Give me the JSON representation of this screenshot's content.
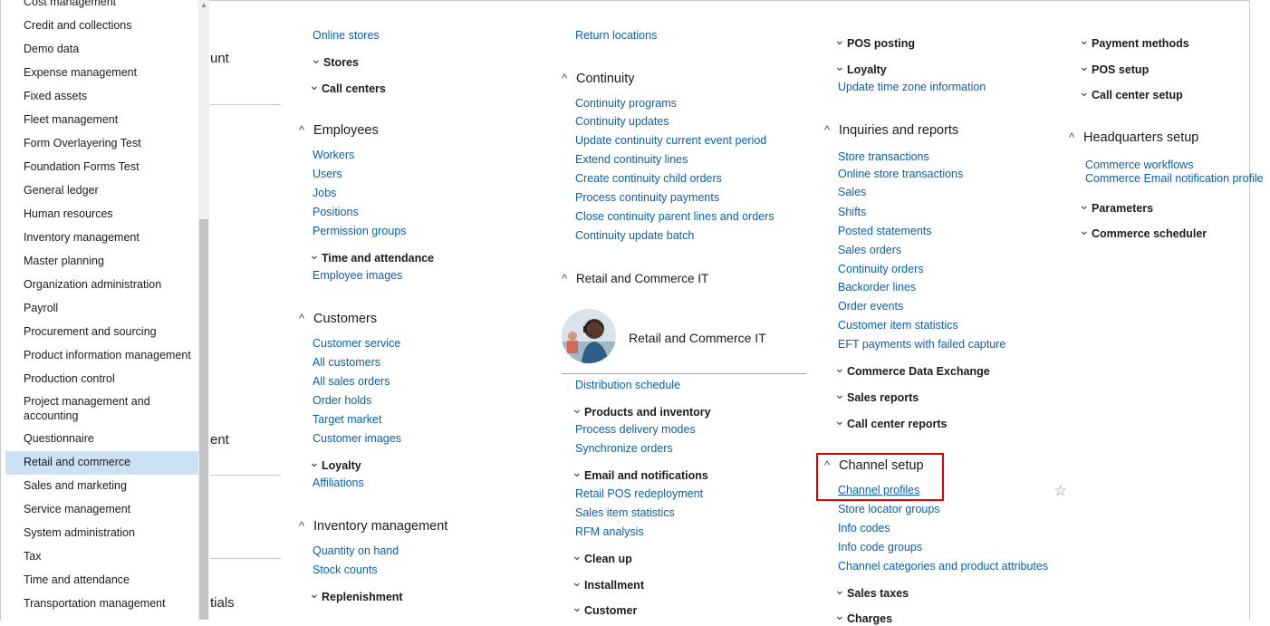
{
  "nav": {
    "items": [
      {
        "label": "Cost management"
      },
      {
        "label": "Credit and collections"
      },
      {
        "label": "Demo data"
      },
      {
        "label": "Expense management"
      },
      {
        "label": "Fixed assets"
      },
      {
        "label": "Fleet management"
      },
      {
        "label": "Form Overlayering Test"
      },
      {
        "label": "Foundation Forms Test"
      },
      {
        "label": "General ledger"
      },
      {
        "label": "Human resources"
      },
      {
        "label": "Inventory management"
      },
      {
        "label": "Master planning"
      },
      {
        "label": "Organization administration"
      },
      {
        "label": "Payroll"
      },
      {
        "label": "Procurement and sourcing"
      },
      {
        "label": "Product information management"
      },
      {
        "label": "Production control"
      },
      {
        "label": "Project management and accounting"
      },
      {
        "label": "Questionnaire"
      },
      {
        "label": "Retail and commerce",
        "selected": true
      },
      {
        "label": "Sales and marketing"
      },
      {
        "label": "Service management"
      },
      {
        "label": "System administration"
      },
      {
        "label": "Tax"
      },
      {
        "label": "Time and attendance"
      },
      {
        "label": "Transportation management"
      }
    ]
  },
  "behind": {
    "t1": "unt",
    "t2": "ent",
    "t3": "tials"
  },
  "col1": {
    "online_stores": "Online stores",
    "stores": "Stores",
    "call_centers": "Call centers",
    "employees": "Employees",
    "workers": "Workers",
    "users": "Users",
    "jobs": "Jobs",
    "positions": "Positions",
    "permission_groups": "Permission groups",
    "time_and_attendance": "Time and attendance",
    "employee_images": "Employee images",
    "customers": "Customers",
    "customer_service": "Customer service",
    "all_customers": "All customers",
    "all_sales_orders": "All sales orders",
    "order_holds": "Order holds",
    "target_market": "Target market",
    "customer_images": "Customer images",
    "loyalty": "Loyalty",
    "affiliations": "Affiliations",
    "inventory_management": "Inventory management",
    "quantity_on_hand": "Quantity on hand",
    "stock_counts": "Stock counts",
    "replenishment": "Replenishment"
  },
  "col2": {
    "return_locations": "Return locations",
    "continuity": "Continuity",
    "continuity_programs": "Continuity programs",
    "continuity_updates": "Continuity updates",
    "update_continuity_current": "Update continuity current event period",
    "extend_continuity_lines": "Extend continuity lines",
    "create_continuity_child": "Create continuity child orders",
    "process_continuity_payments": "Process continuity payments",
    "close_continuity_parent": "Close continuity parent lines and orders",
    "continuity_update_batch": "Continuity update batch",
    "retail_it": "Retail and Commerce IT",
    "tile_title": "Retail and Commerce IT",
    "distribution_schedule": "Distribution schedule",
    "products_inventory": "Products and inventory",
    "process_delivery_modes": "Process delivery modes",
    "synchronize_orders": "Synchronize orders",
    "email_notifications": "Email and notifications",
    "retail_pos_redeployment": "Retail POS redeployment",
    "sales_item_statistics": "Sales item statistics",
    "rfm_analysis": "RFM analysis",
    "clean_up": "Clean up",
    "installment": "Installment",
    "customer": "Customer"
  },
  "col3": {
    "pos_posting": "POS posting",
    "loyalty": "Loyalty",
    "update_time_zone": "Update time zone information",
    "inquiries_reports": "Inquiries and reports",
    "store_transactions": "Store transactions",
    "online_store_transactions": "Online store transactions",
    "sales": "Sales",
    "shifts": "Shifts",
    "posted_statements": "Posted statements",
    "sales_orders": "Sales orders",
    "continuity_orders": "Continuity orders",
    "backorder_lines": "Backorder lines",
    "order_events": "Order events",
    "customer_item_statistics": "Customer item statistics",
    "eft_payments": "EFT payments with failed capture",
    "commerce_data_exchange": "Commerce Data Exchange",
    "sales_reports": "Sales reports",
    "call_center_reports": "Call center reports",
    "channel_setup": "Channel setup",
    "channel_profiles": "Channel profiles",
    "store_locator_groups": "Store locator groups",
    "info_codes": "Info codes",
    "info_code_groups": "Info code groups",
    "channel_categories": "Channel categories and product attributes",
    "sales_taxes": "Sales taxes",
    "charges": "Charges"
  },
  "col4": {
    "payment_methods": "Payment methods",
    "pos_setup": "POS setup",
    "call_center_setup": "Call center setup",
    "headquarters_setup": "Headquarters setup",
    "commerce_workflows": "Commerce workflows",
    "commerce_email": "Commerce Email notification profile",
    "parameters": "Parameters",
    "commerce_scheduler": "Commerce scheduler"
  },
  "icons": {
    "star": "star-outline-icon",
    "collapse": "chevron-up-icon",
    "expand": "chevron-down-icon"
  },
  "colors": {
    "link": "#0b5fa8",
    "selected_nav": "#cce1f4",
    "highlight": "#e00000"
  }
}
